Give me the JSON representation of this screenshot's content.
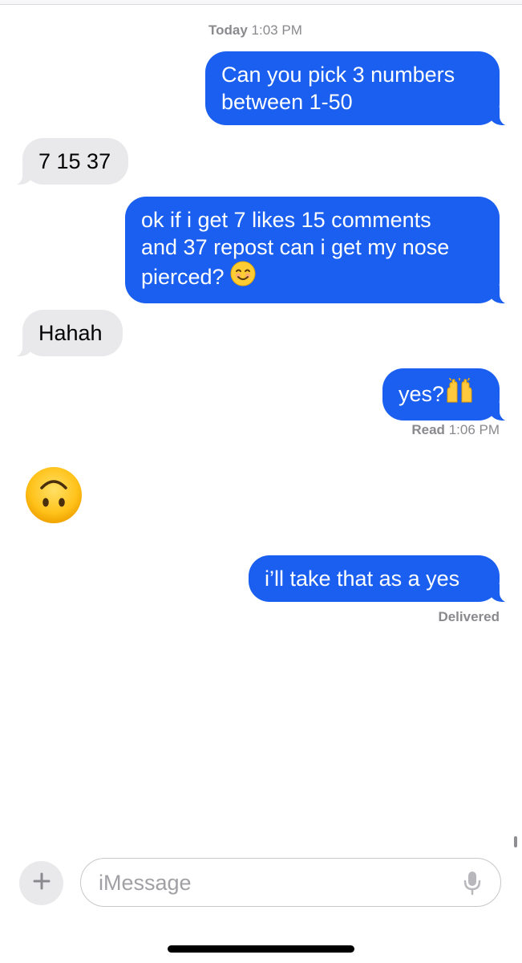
{
  "conversation": {
    "header_timestamp": {
      "day": "Today",
      "time": "1:03 PM"
    },
    "messages": [
      {
        "direction": "outgoing",
        "lines": [
          "Can you pick 3 numbers",
          "between 1-50"
        ]
      },
      {
        "direction": "incoming",
        "lines": [
          "7 15 37"
        ]
      },
      {
        "direction": "outgoing",
        "lines": [
          "ok if i get 7 likes 15 comments",
          "and 37 repost can i get my nose",
          "pierced?"
        ],
        "trailing_emoji": "😊"
      },
      {
        "direction": "incoming",
        "lines": [
          "Hahah"
        ]
      },
      {
        "direction": "outgoing",
        "text": "yes?",
        "trailing_emoji": "🙌"
      },
      {
        "direction": "incoming",
        "emoji": "🙃",
        "emoji_name": "upside-down-face"
      },
      {
        "direction": "outgoing",
        "lines": [
          "i’ll take that as a yes"
        ]
      }
    ],
    "read_receipt": {
      "label": "Read",
      "time": "1:06 PM"
    },
    "delivered_status": "Delivered"
  },
  "composer": {
    "placeholder": "iMessage",
    "value": "",
    "plus_icon": "plus-icon",
    "mic_icon": "microphone-icon"
  },
  "colors": {
    "outgoing_bubble": "#1a5ff0",
    "incoming_bubble": "#e9e9eb",
    "meta_text": "#8a8a8e"
  }
}
